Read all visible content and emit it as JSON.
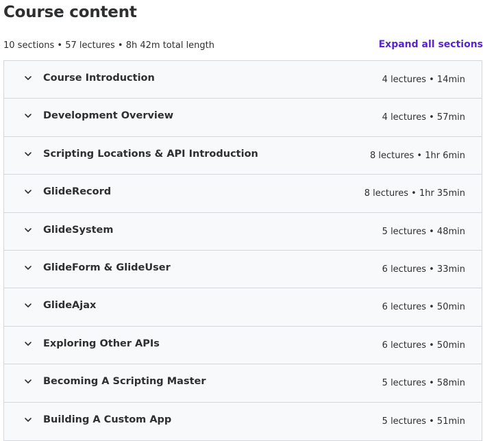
{
  "header": {
    "title": "Course content",
    "summary": "10 sections • 57 lectures • 8h 42m total length",
    "expand_label": "Expand all sections"
  },
  "colors": {
    "accent": "#5624d0",
    "row_background": "#f7f9fa",
    "border": "#d1d7dc",
    "text": "#2d2f31"
  },
  "sections": [
    {
      "title": "Course Introduction",
      "meta": "4 lectures • 14min"
    },
    {
      "title": "Development Overview",
      "meta": "4 lectures • 57min"
    },
    {
      "title": "Scripting Locations & API Introduction",
      "meta": "8 lectures • 1hr 6min"
    },
    {
      "title": "GlideRecord",
      "meta": "8 lectures • 1hr 35min"
    },
    {
      "title": "GlideSystem",
      "meta": "5 lectures • 48min"
    },
    {
      "title": "GlideForm & GlideUser",
      "meta": "6 lectures • 33min"
    },
    {
      "title": "GlideAjax",
      "meta": "6 lectures • 50min"
    },
    {
      "title": "Exploring Other APIs",
      "meta": "6 lectures • 50min"
    },
    {
      "title": "Becoming A Scripting Master",
      "meta": "5 lectures • 58min"
    },
    {
      "title": "Building A Custom App",
      "meta": "5 lectures • 51min"
    }
  ]
}
